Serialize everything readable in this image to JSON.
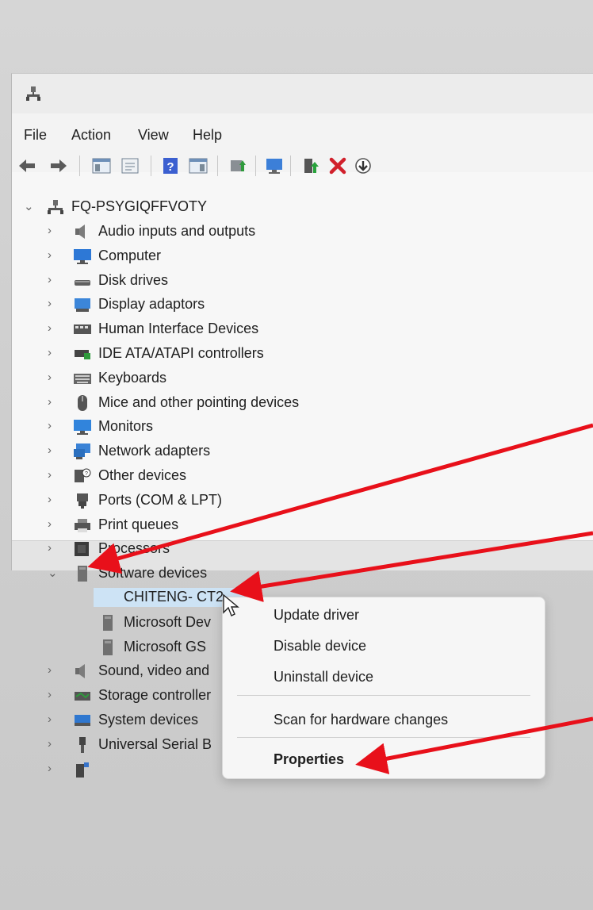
{
  "menu": {
    "file": "File",
    "action": "Action",
    "view": "View",
    "help": "Help"
  },
  "toolbar": {
    "buttons": [
      "back-icon",
      "forward-icon",
      "show-hide-tree-icon",
      "properties-icon",
      "help-icon",
      "action-pane-icon",
      "update-driver-icon",
      "scan-hardware-icon",
      "enable-device-icon",
      "uninstall-icon",
      "download-icon"
    ]
  },
  "tree": {
    "root": "FQ-PSYGIQFFVOTY",
    "categories": [
      {
        "label": "Audio inputs and outputs",
        "icon": "speaker-icon"
      },
      {
        "label": "Computer",
        "icon": "computer-icon"
      },
      {
        "label": "Disk drives",
        "icon": "disk-drive-icon"
      },
      {
        "label": "Display adaptors",
        "icon": "display-adapter-icon"
      },
      {
        "label": "Human Interface Devices",
        "icon": "hid-icon"
      },
      {
        "label": "IDE ATA/ATAPI controllers",
        "icon": "ide-controller-icon"
      },
      {
        "label": "Keyboards",
        "icon": "keyboard-icon"
      },
      {
        "label": "Mice and other pointing devices",
        "icon": "mouse-icon"
      },
      {
        "label": "Monitors",
        "icon": "monitor-icon"
      },
      {
        "label": "Network adapters",
        "icon": "network-adapter-icon"
      },
      {
        "label": "Other devices",
        "icon": "other-devices-icon"
      },
      {
        "label": "Ports (COM & LPT)",
        "icon": "port-icon"
      },
      {
        "label": "Print queues",
        "icon": "printer-icon"
      },
      {
        "label": "Processors",
        "icon": "processor-icon"
      },
      {
        "label": "Software devices",
        "icon": "software-device-icon"
      },
      {
        "label": "Sound, video and",
        "icon": "speaker-icon"
      },
      {
        "label": "Storage controller",
        "icon": "storage-controller-icon"
      },
      {
        "label": "System devices",
        "icon": "system-devices-icon"
      },
      {
        "label": "Universal Serial B",
        "icon": "usb-icon"
      },
      {
        "label": "",
        "icon": "usb-connector-icon"
      }
    ],
    "software_children": [
      "CHITENG- CT2",
      "Microsoft Dev",
      "Microsoft GS"
    ]
  },
  "context_menu": {
    "update": "Update driver",
    "disable": "Disable device",
    "uninstall": "Uninstall device",
    "scan": "Scan for hardware changes",
    "properties": "Properties"
  },
  "colors": {
    "annotation_arrow": "#e8101a",
    "selection": "#cde3f5"
  }
}
